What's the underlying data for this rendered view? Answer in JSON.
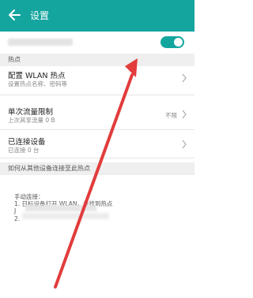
{
  "header": {
    "title": "设置",
    "back_icon": "back-arrow-icon"
  },
  "toggle": {
    "enabled": true,
    "color": "#13a69f"
  },
  "section1": {
    "label": "热点"
  },
  "rows": [
    {
      "title": "配置 WLAN 热点",
      "subtitle": "设置热点名称、密码等",
      "value": ""
    },
    {
      "title": "单次流量限制",
      "subtitle": "上次其享流量 0 B",
      "value": "不限"
    },
    {
      "title": "已连接设备",
      "subtitle": "已连接 0 台",
      "value": ""
    }
  ],
  "section2": {
    "label": "如何从其他设备连接至此热点"
  },
  "help": {
    "line1": "手动连接：",
    "line2": "1. 日标设备打开 WLAN，并找到热点",
    "line3": "J",
    "line4": "2."
  },
  "colors": {
    "header": "#14a59f",
    "arrow": "#e23c3c"
  }
}
